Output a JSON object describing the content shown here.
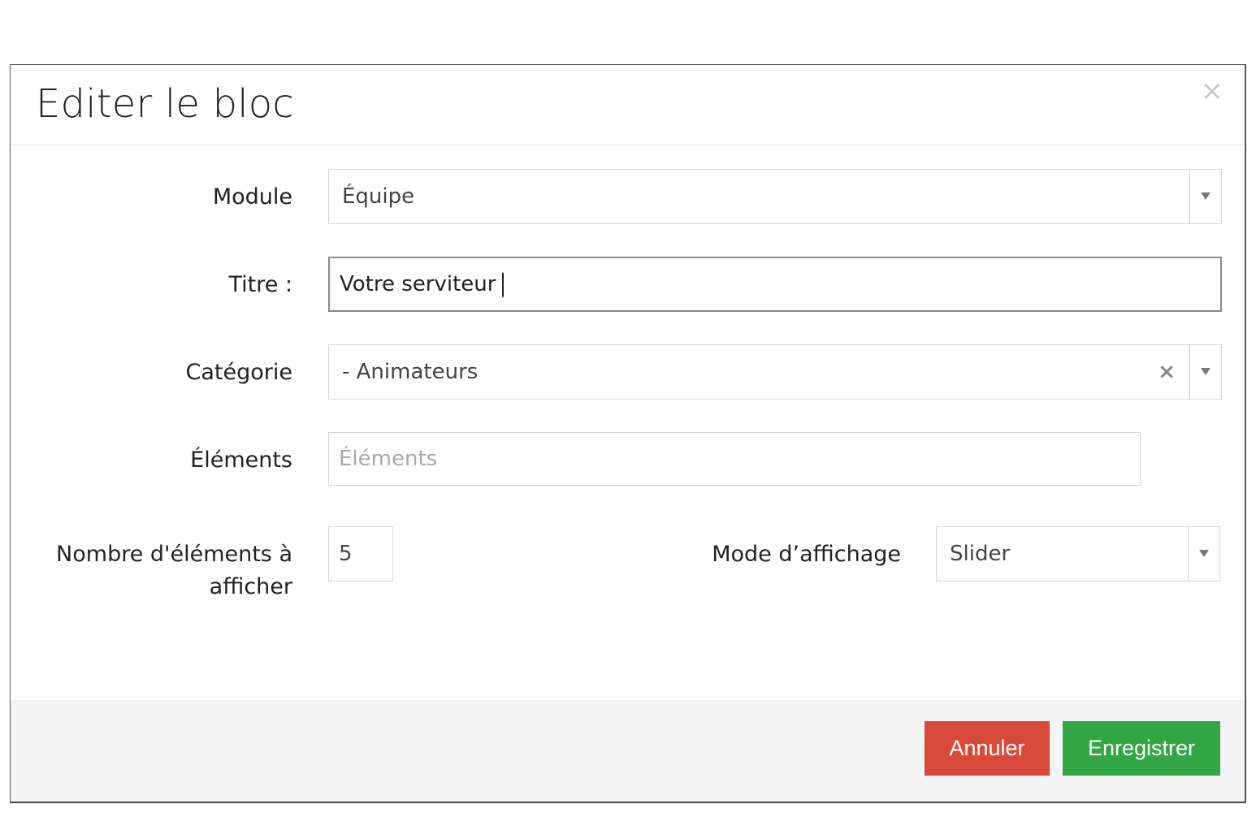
{
  "modal": {
    "title": "Editer le bloc",
    "close_symbol": "×"
  },
  "form": {
    "module": {
      "label": "Module",
      "value": "Équipe"
    },
    "titre": {
      "label": "Titre :",
      "value": "Votre serviteur"
    },
    "categorie": {
      "label": "Catégorie",
      "value": "- Animateurs",
      "clear_symbol": "×"
    },
    "elements": {
      "label": "Éléments",
      "placeholder": "Éléments"
    },
    "nombre": {
      "label_line1": "Nombre d'éléments à",
      "label_line2": "afficher",
      "value": "5"
    },
    "mode": {
      "label": "Mode d’affichage",
      "value": "Slider"
    }
  },
  "footer": {
    "cancel_label": "Annuler",
    "save_label": "Enregistrer"
  },
  "colors": {
    "cancel": "#d9493a",
    "save": "#33a645"
  }
}
